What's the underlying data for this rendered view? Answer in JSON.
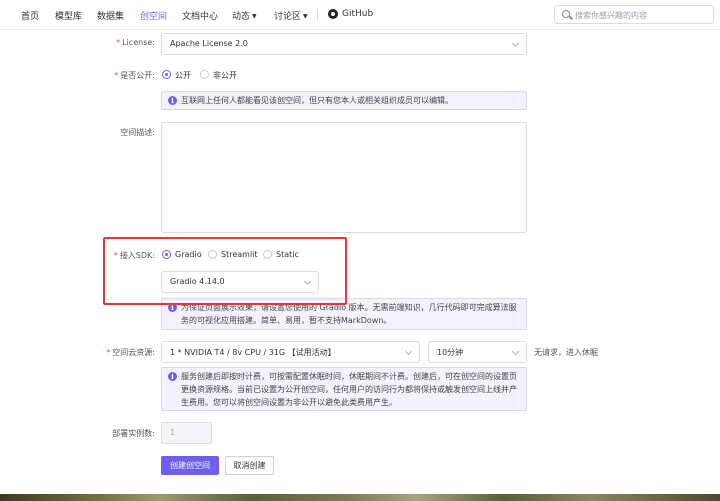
{
  "nav": {
    "items": [
      {
        "label": "首页"
      },
      {
        "label": "模型库"
      },
      {
        "label": "数据集"
      },
      {
        "label": "创空间"
      },
      {
        "label": "文档中心"
      },
      {
        "label": "动态"
      },
      {
        "label": "讨论区"
      }
    ],
    "github_label": "GitHub",
    "search_placeholder": "搜索你感兴趣的内容",
    "active_color": "#6d5ff0"
  },
  "form": {
    "license": {
      "label": "License:",
      "value": "Apache License 2.0"
    },
    "visibility": {
      "label": "是否公开:",
      "options": [
        {
          "label": "公开",
          "selected": true
        },
        {
          "label": "非公开",
          "selected": false
        }
      ],
      "notice": "互联网上任何人都能看见该创空间，但只有您本人或相关组织成员可以编辑。"
    },
    "description": {
      "label": "空间描述:",
      "value": ""
    },
    "sdk": {
      "label": "接入SDK:",
      "options": [
        {
          "label": "Gradio",
          "selected": true
        },
        {
          "label": "Streamlit",
          "selected": false
        },
        {
          "label": "Static",
          "selected": false
        }
      ],
      "version": "Gradio 4.14.0",
      "notice_line1": "为保证页面展示效果，请设置您使用的 Gradio 版本。无需前端知识，几行代码即可完成算法服",
      "notice_line2": "务的可视化应用搭建。简单、易用，暂不支持MarkDown。"
    },
    "resource": {
      "label": "空间云资源:",
      "value": "1 * NVIDIA T4 / 8v CPU / 31G 【试用活动】",
      "sleep_value": "10分钟",
      "sleep_hint": "无请求，进入休眠",
      "notice_line1": "服务创建后即按时计费，可按需配置休眠时间，休眠期间不计费。创建后，可在创空间的设置页",
      "notice_line2": "更换资源规格。当前已设置为公开创空间，任何用户的访问行为都将保持或触发创空间上线并产",
      "notice_line3": "生费用。您可以将创空间设置为非公开以避免此类费用产生。"
    },
    "instances": {
      "label": "部署实例数:",
      "value": "1"
    },
    "buttons": {
      "create": "创建创空间",
      "cancel": "取消创建"
    }
  }
}
